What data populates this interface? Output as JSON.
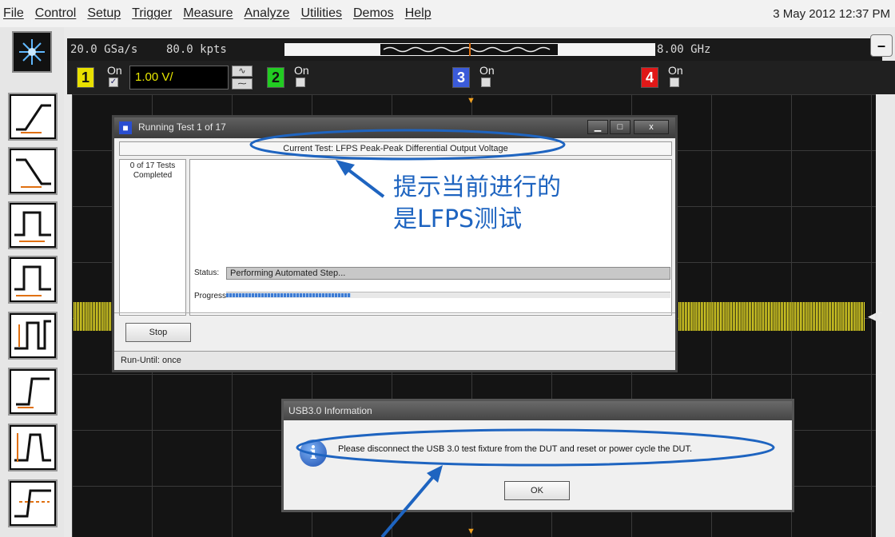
{
  "menu": [
    "File",
    "Control",
    "Setup",
    "Trigger",
    "Measure",
    "Analyze",
    "Utilities",
    "Demos",
    "Help"
  ],
  "datetime": "3 May 2012 12:37 PM",
  "acquisition": {
    "sample_rate": "20.0 GSa/s",
    "memory": "80.0 kpts",
    "bandwidth": "8.00 GHz"
  },
  "window_button": "–",
  "channels": [
    {
      "number": "1",
      "state": "On",
      "checked": "✓",
      "scale": "1.00 V/",
      "color": "#e8e000"
    },
    {
      "number": "2",
      "state": "On",
      "checked": "",
      "color": "#22cc22"
    },
    {
      "number": "3",
      "state": "On",
      "checked": "",
      "color": "#3b5bd9"
    },
    {
      "number": "4",
      "state": "On",
      "checked": "",
      "color": "#e01818"
    }
  ],
  "coupling_icons": [
    "∿",
    "⁓"
  ],
  "trigger_marker": "▼",
  "reference_marker": "◀T",
  "running_dialog": {
    "title": "Running Test 1 of 17",
    "window_buttons": [
      "▁",
      "□",
      "x"
    ],
    "current_test": "Current Test: LFPS Peak-Peak Differential Output Voltage",
    "completed": "0 of 17 Tests Completed",
    "status_label": "Status:",
    "status_value": "Performing Automated Step...",
    "progress_label": "Progress:",
    "progress_fraction": 0.28,
    "stop_label": "Stop",
    "run_until": "Run-Until: once"
  },
  "annotation": {
    "line1": "提示当前进行的",
    "line2": "是LFPS测试",
    "color": "#1e64c0"
  },
  "info_dialog": {
    "title": "USB3.0 Information",
    "icon_glyph": "i",
    "message": "Please disconnect the USB 3.0 test fixture from the DUT and reset or power cycle the DUT.",
    "ok_label": "OK"
  },
  "colors": {
    "trace": "#f3e82a",
    "annotation_blue": "#1e64c0"
  }
}
